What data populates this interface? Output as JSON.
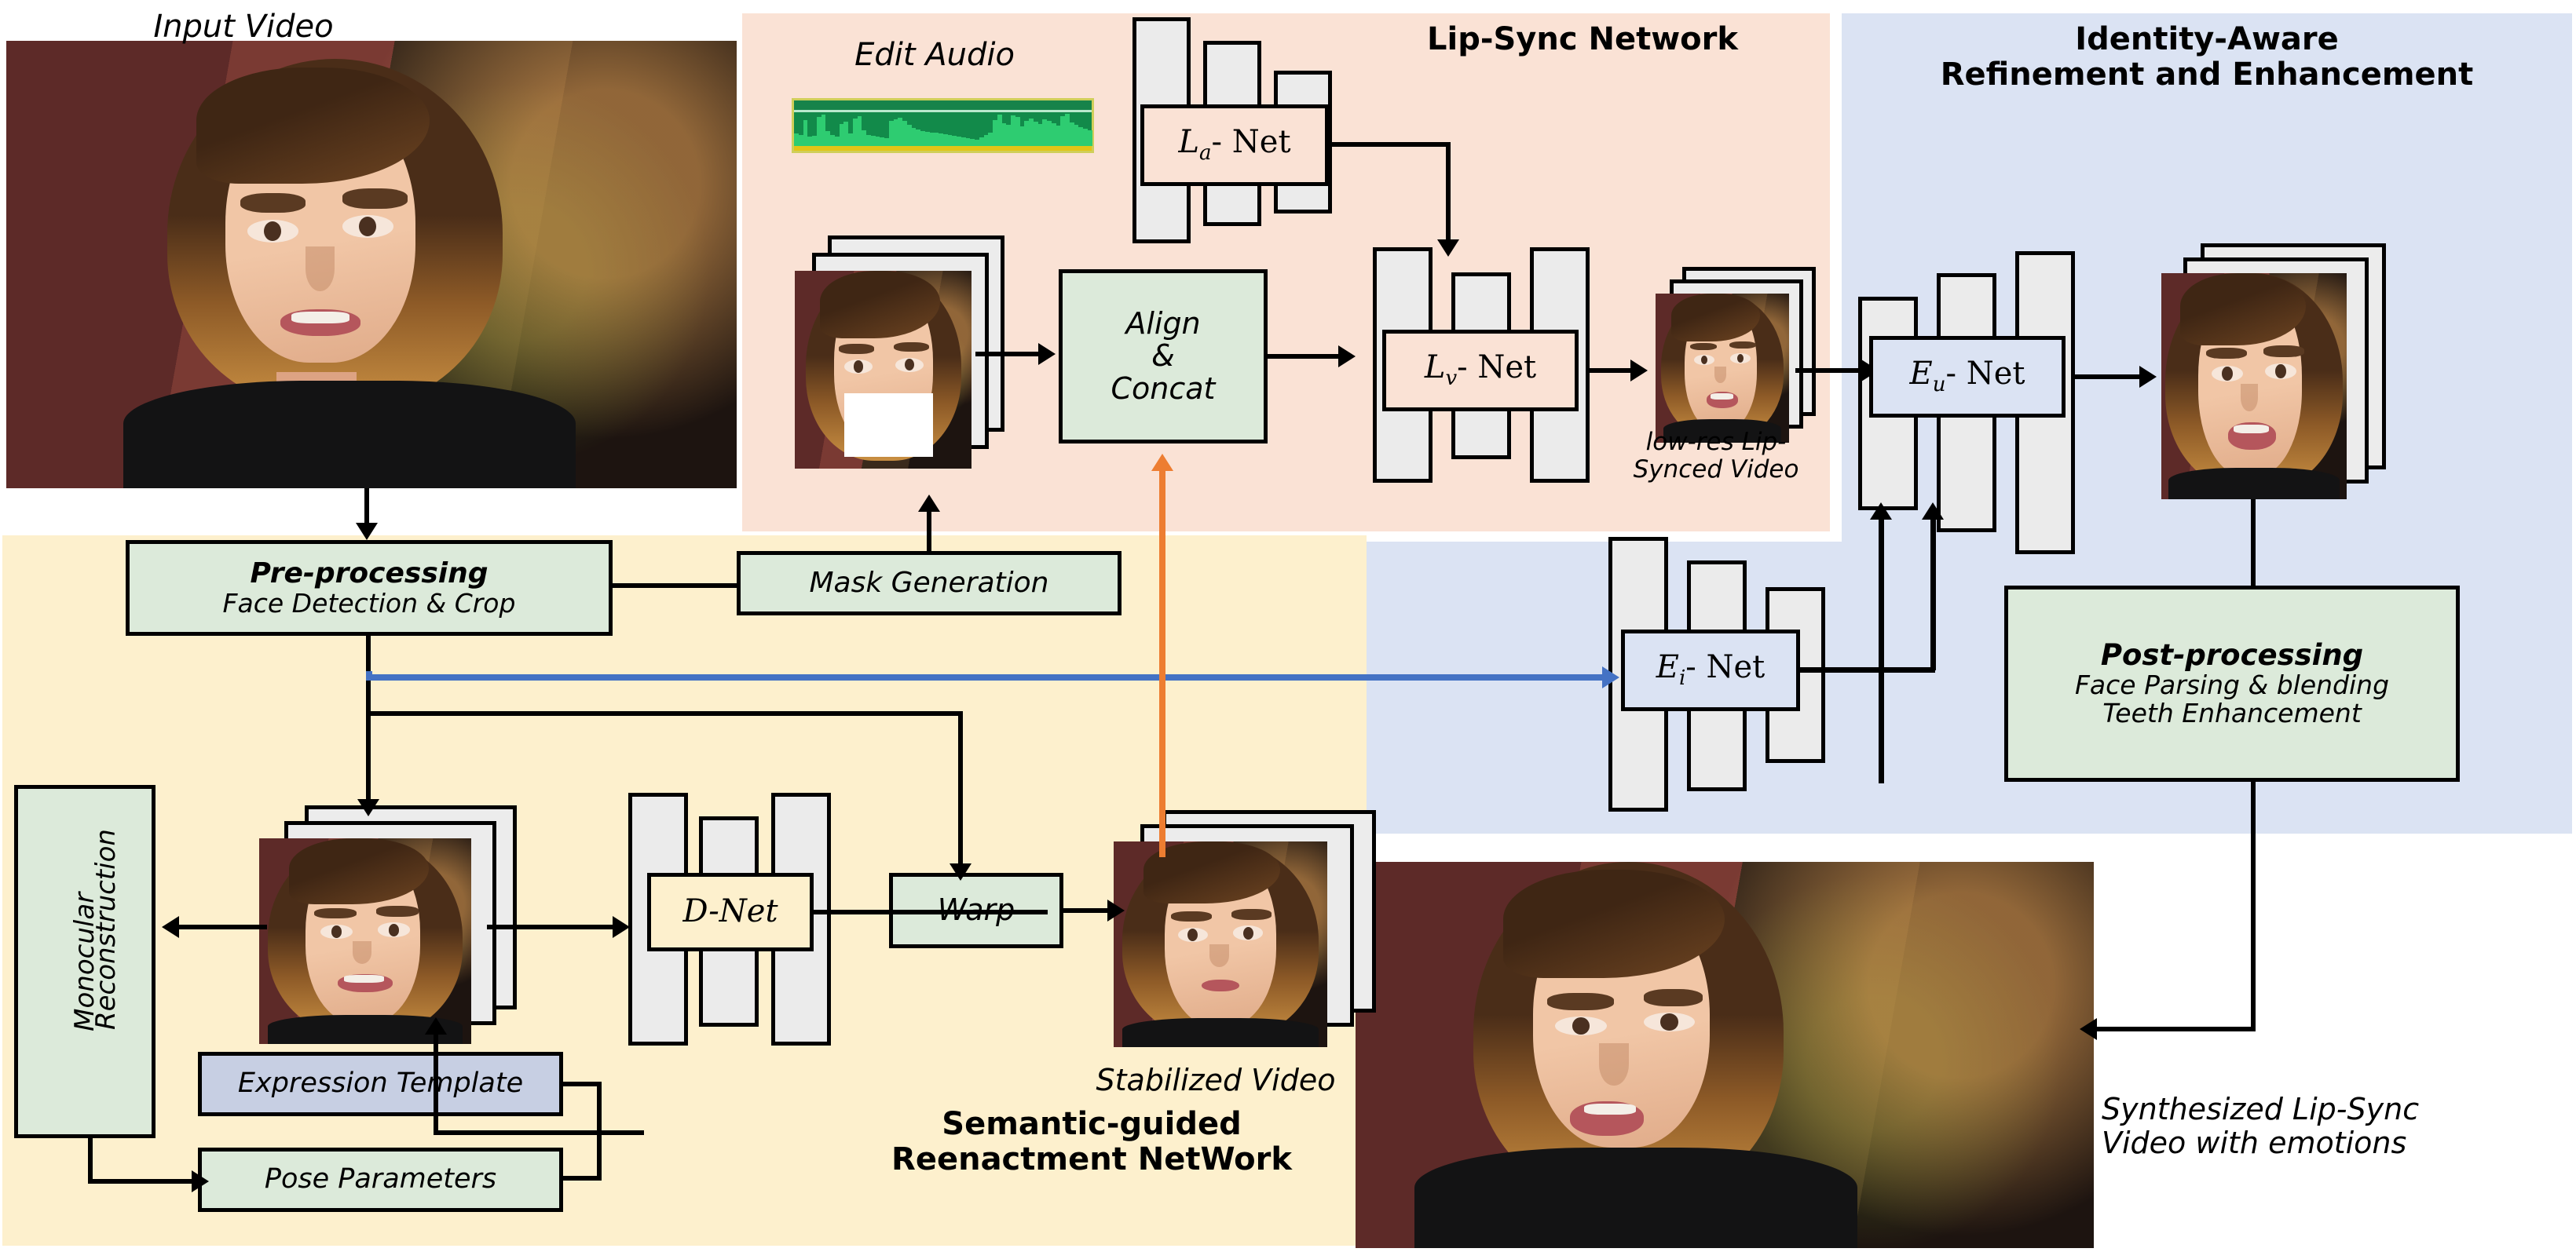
{
  "panels": {
    "lipsync": {
      "title": "Lip-Sync Network",
      "color": "#fae2d5"
    },
    "identity": {
      "title_line1": "Identity-Aware",
      "title_line2": "Refinement and Enhancement",
      "color": "#dbe3f3"
    },
    "semantic": {
      "title_line1": "Semantic-guided",
      "title_line2": "Reenactment NetWork",
      "color": "#fdf0cd"
    }
  },
  "captions": {
    "input_video": "Input Video",
    "edit_audio": "Edit Audio",
    "lowres_line1": "low-res Lip-",
    "lowres_line2": "Synced Video",
    "stabilized": "Stabilized Video",
    "synth_line1": "Synthesized Lip-Sync",
    "synth_line2": "Video with emotions"
  },
  "blocks": {
    "preprocessing": {
      "line1": "Pre-processing",
      "line2": "Face Detection & Crop",
      "fill": "#dceada"
    },
    "mask_generation": {
      "label": "Mask Generation",
      "fill": "#dceada"
    },
    "align_concat": {
      "line1": "Align",
      "line2": "&",
      "line3": "Concat",
      "fill": "#dceada"
    },
    "la_net": {
      "label": "L",
      "sub": "a",
      "suffix": "- Net",
      "fill": "#fae2d5"
    },
    "lv_net": {
      "label": "L",
      "sub": "v",
      "suffix": "- Net",
      "fill": "#fae2d5"
    },
    "eu_net": {
      "label": "E",
      "sub": "u",
      "suffix": "- Net",
      "fill": "#dbe3f3"
    },
    "ei_net": {
      "label": "E",
      "sub": "i",
      "suffix": "- Net",
      "fill": "#dbe3f3"
    },
    "d_net": {
      "label": "D-Net",
      "fill": "#fdf0cd"
    },
    "warp": {
      "label": "Warp",
      "fill": "#dceada"
    },
    "monocular": {
      "line1": "Monocular",
      "line2": "Reconstruction",
      "fill": "#dceada"
    },
    "expression_template": {
      "label": "Expression Template",
      "fill": "#c7cfe3"
    },
    "pose_parameters": {
      "label": "Pose Parameters",
      "fill": "#dceada"
    },
    "postprocessing": {
      "line1": "Post-processing",
      "line2": "Face Parsing & blending",
      "line3": "Teeth Enhancement",
      "fill": "#dceada"
    }
  },
  "colors": {
    "identity_flow_arrow": "#4472c4",
    "stabilized_flow_arrow": "#ed7d31",
    "conv_bar": "#ebebeb",
    "stroke": "#000000",
    "waveform": "#2ecc71"
  },
  "waveform": {
    "amplitudes": [
      34,
      30,
      72,
      26,
      28,
      80,
      86,
      42,
      30,
      26,
      60,
      66,
      34,
      76,
      82,
      44,
      30,
      28,
      26,
      24,
      22,
      70,
      74,
      78,
      68,
      58,
      50,
      46,
      42,
      40,
      38,
      36,
      34,
      32,
      30,
      28,
      26,
      24,
      22,
      20,
      18,
      24,
      30,
      36,
      72,
      86,
      62,
      58,
      84,
      80,
      54,
      70,
      76,
      66,
      60,
      74,
      70,
      62,
      56,
      82,
      88,
      64,
      58,
      52,
      48,
      44
    ]
  }
}
